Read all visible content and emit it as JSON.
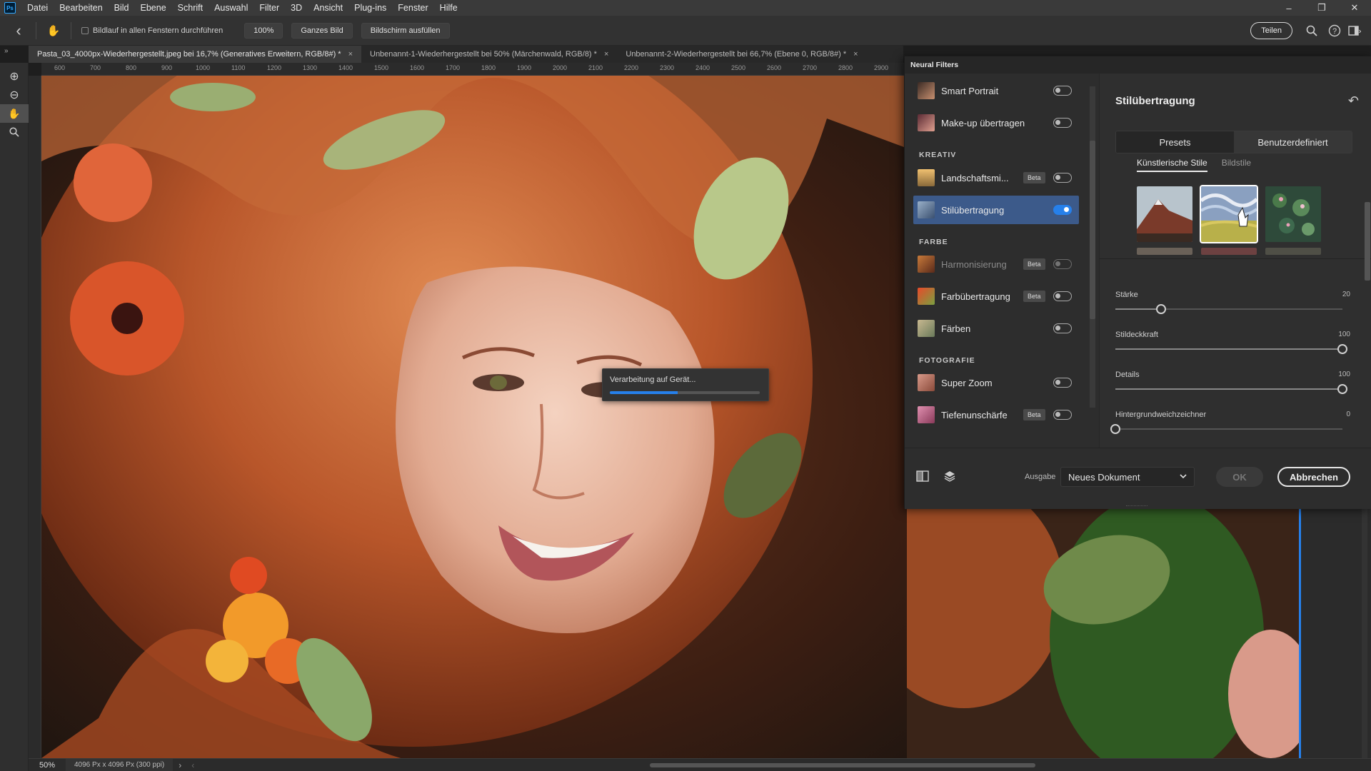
{
  "app": {
    "logo": "Ps"
  },
  "menu": [
    "Datei",
    "Bearbeiten",
    "Bild",
    "Ebene",
    "Schrift",
    "Auswahl",
    "Filter",
    "3D",
    "Ansicht",
    "Plug-ins",
    "Fenster",
    "Hilfe"
  ],
  "window_controls": {
    "minimize": "–",
    "maximize": "❐",
    "close": "✕"
  },
  "options_bar": {
    "scroll_all_label": "Bildlauf in allen Fenstern durchführen",
    "zoom_100": "100%",
    "fit_screen": "Ganzes Bild",
    "fill_screen": "Bildschirm ausfüllen",
    "share": "Teilen"
  },
  "tabs": [
    {
      "label": "Pasta_03_4000px-Wiederhergestellt.jpeg bei 16,7% (Generatives Erweitern, RGB/8#) *",
      "close": "×"
    },
    {
      "label": "Unbenannt-1-Wiederhergestellt bei 50% (Märchenwald, RGB/8) *",
      "close": "×"
    },
    {
      "label": "Unbenannt-2-Wiederhergestellt bei 66,7% (Ebene 0, RGB/8#) *",
      "close": "×"
    }
  ],
  "ruler": {
    "labels": [
      "600",
      "700",
      "800",
      "900",
      "1000",
      "1100",
      "1200",
      "1300",
      "1400",
      "1500",
      "1600",
      "1700",
      "1800",
      "1900",
      "2000",
      "2100",
      "2200",
      "2300",
      "2400",
      "2500",
      "2600",
      "2700",
      "2800",
      "2900"
    ]
  },
  "progress": {
    "label": "Verarbeitung auf Gerät...",
    "fraction": 0.45
  },
  "status": {
    "zoom": "50%",
    "doc_size": "4096 Px x 4096 Px (300 ppi)",
    "chevron": "›",
    "chevron2": "‹"
  },
  "neural_filters": {
    "title": "Neural Filters",
    "header_icons": "«  ✕",
    "categories": {
      "kreativ": "KREATIV",
      "farbe": "FARBE",
      "fotografie": "FOTOGRAFIE"
    },
    "filters": [
      {
        "name": "Smart Portrait",
        "beta": "",
        "on": false
      },
      {
        "name": "Make-up übertragen",
        "beta": "",
        "on": false
      },
      {
        "name": "Landschaftsmi...",
        "beta": "Beta",
        "on": false
      },
      {
        "name": "Stilübertragung",
        "beta": "",
        "on": true
      },
      {
        "name": "Harmonisierung",
        "beta": "Beta",
        "on": false
      },
      {
        "name": "Farbübertragung",
        "beta": "Beta",
        "on": false
      },
      {
        "name": "Färben",
        "beta": "",
        "on": false
      },
      {
        "name": "Super Zoom",
        "beta": "",
        "on": false
      },
      {
        "name": "Tiefenunschärfe",
        "beta": "Beta",
        "on": false
      }
    ],
    "settings": {
      "title": "Stilübertragung",
      "seg": {
        "presets": "Presets",
        "custom": "Benutzerdefiniert"
      },
      "subtabs": {
        "artistic": "Künstlerische Stile",
        "image": "Bildstile"
      },
      "sliders": [
        {
          "label": "Stärke",
          "value": "20",
          "fraction": 0.2
        },
        {
          "label": "Stildeckkraft",
          "value": "100",
          "fraction": 1.0
        },
        {
          "label": "Details",
          "value": "100",
          "fraction": 1.0
        },
        {
          "label": "Hintergrundweichzeichner",
          "value": "0",
          "fraction": 0.0
        }
      ]
    },
    "footer": {
      "output_label": "Ausgabe",
      "output_value": "Neues Dokument",
      "ok": "OK",
      "cancel": "Abbrechen"
    }
  },
  "icons": {
    "back": "‹",
    "hand": "✋",
    "zoom_in": "⊕",
    "zoom_out": "⊖",
    "magnify": "🔍︎",
    "help": "?",
    "workspace": "▣",
    "reset": "↶",
    "compare": "◧",
    "layers": "≋",
    "chevron_down": "⌄",
    "hand_tool": "✋"
  },
  "colors": {
    "accent": "#2680eb",
    "selected_row": "#3c5a8a"
  }
}
